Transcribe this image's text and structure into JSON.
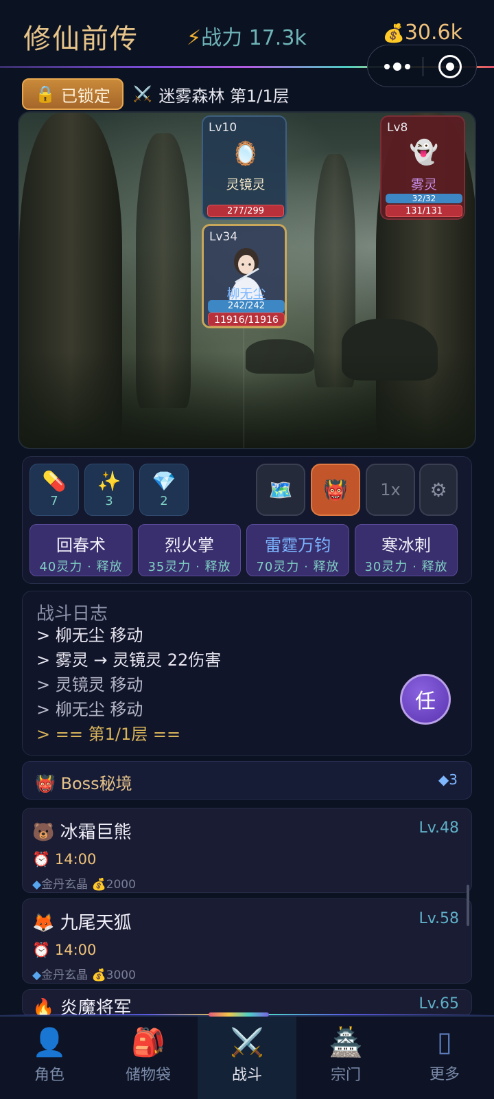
{
  "header": {
    "title": "修仙前传",
    "power_icon": "⚡",
    "power_text": "战力 17.3k",
    "gold_icon": "💰",
    "gold_value": "30.6k"
  },
  "location": {
    "lock_label": "已锁定",
    "lock_icon": "🔒",
    "sword_icon": "⚔️",
    "stage_name": "迷雾森林 第1/1层"
  },
  "battle": {
    "enemies": [
      {
        "level": "Lv10",
        "icon": "🪞",
        "name": "灵镜灵",
        "hp": "277/299"
      },
      {
        "level": "Lv8",
        "icon": "👻",
        "name": "雾灵",
        "mp": "32/32",
        "hp": "131/131"
      }
    ],
    "hero": {
      "level": "Lv34",
      "name": "柳无尘",
      "mp": "242/242",
      "hp": "11916/11916"
    }
  },
  "items": [
    {
      "icon": "💊",
      "name": "pill-icon",
      "count": "7"
    },
    {
      "icon": "✨",
      "name": "sparkle-icon",
      "count": "3"
    },
    {
      "icon": "💎",
      "name": "gem-icon",
      "count": "2"
    }
  ],
  "tools": {
    "map_icon": "🗺️",
    "boss_icon": "👹",
    "speed_label": "1x",
    "settings_icon": "⚙"
  },
  "skills": [
    {
      "name": "回春术",
      "cost": "40灵力 · 释放"
    },
    {
      "name": "烈火掌",
      "cost": "35灵力 · 释放"
    },
    {
      "name": "雷霆万钧",
      "cost": "70灵力 · 释放"
    },
    {
      "name": "寒冰刺",
      "cost": "30灵力 · 释放"
    }
  ],
  "log": {
    "title": "战斗日志",
    "lines": [
      "> 柳无尘 移动",
      "> 雾灵 → 灵镜灵 22伤害",
      "> 灵镜灵 移动",
      "> 柳无尘 移动",
      "> == 第1/1层 =="
    ],
    "task_button": "任"
  },
  "boss_section": {
    "icon": "👹",
    "title": "Boss秘境",
    "count_icon": "◆",
    "count": "3",
    "bosses": [
      {
        "icon": "🐻",
        "name": "冰霜巨熊",
        "level": "Lv.48",
        "time_icon": "⏰",
        "time": "14:00",
        "reward_gem": "◆",
        "reward_item": "金丹玄晶",
        "reward_gold_icon": "💰",
        "reward_gold": "2000"
      },
      {
        "icon": "🦊",
        "name": "九尾天狐",
        "level": "Lv.58",
        "time_icon": "⏰",
        "time": "14:00",
        "reward_gem": "◆",
        "reward_item": "金丹玄晶",
        "reward_gold_icon": "💰",
        "reward_gold": "3000"
      },
      {
        "icon": "🔥",
        "name": "炎魔将军",
        "level": "Lv.65"
      }
    ]
  },
  "nav": [
    {
      "icon": "👤",
      "label": "角色"
    },
    {
      "icon": "🎒",
      "label": "储物袋"
    },
    {
      "icon": "⚔️",
      "label": "战斗",
      "active": true
    },
    {
      "icon": "🏯",
      "label": "宗门"
    },
    {
      "icon": "▯",
      "label": "更多"
    }
  ]
}
